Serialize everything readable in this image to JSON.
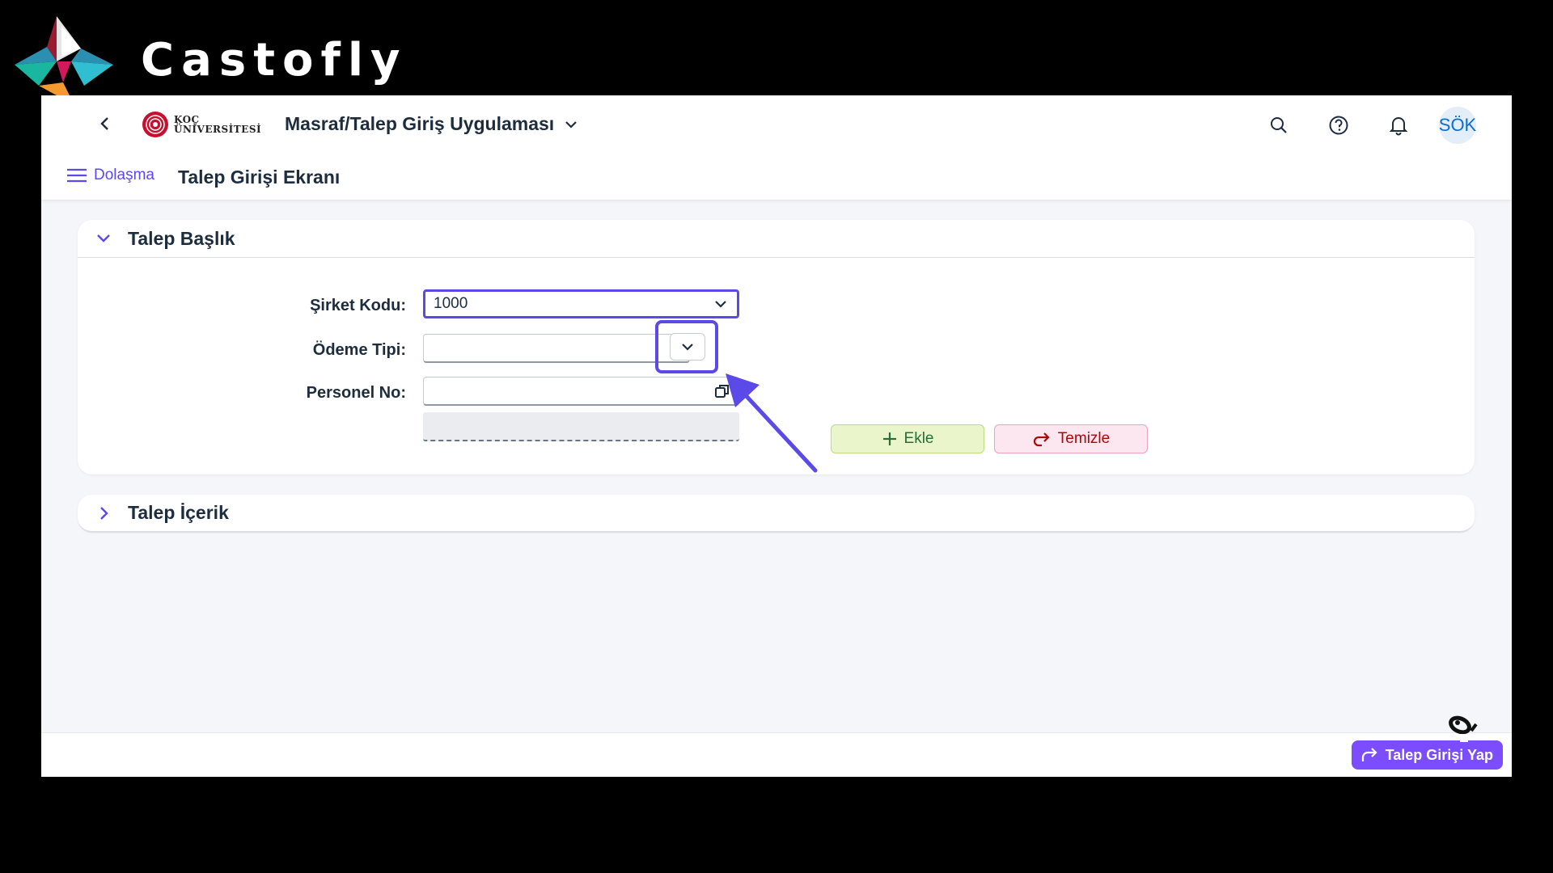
{
  "brand": {
    "name": "Castofly",
    "logo": "castofly-logo"
  },
  "shellbar": {
    "back_icon": "chevron-left-icon",
    "org_logo_line1": "KOÇ",
    "org_logo_line2": "ÜNİVERSİTESİ",
    "app_title": "Masraf/Talep Giriş Uygulaması",
    "app_title_icon": "chevron-down-icon",
    "search_icon": "search-icon",
    "help_icon": "help-icon",
    "notifications_icon": "bell-icon",
    "avatar_initials": "SÖK"
  },
  "subheader": {
    "nav_label": "Dolaşma",
    "nav_icon": "hamburger-menu-icon",
    "page_title": "Talep Girişi Ekranı"
  },
  "header_panel": {
    "title": "Talep Başlık",
    "expanded": true,
    "fields": {
      "company_code_label": "Şirket Kodu:",
      "company_code_value": "1000",
      "payment_type_label": "Ödeme Tipi:",
      "payment_type_value": "",
      "personnel_no_label": "Personel No:",
      "personnel_no_value": ""
    },
    "add_button": "Ekle",
    "clear_button": "Temizle"
  },
  "content_panel": {
    "title": "Talep İçerik",
    "expanded": false
  },
  "footer": {
    "submit_button": "Talep Girişi Yap"
  },
  "colors": {
    "accent": "#5b4ae8",
    "submit": "#7c4dff",
    "add_bg": "#ebf5cb",
    "clear_bg": "#fce6ef"
  }
}
